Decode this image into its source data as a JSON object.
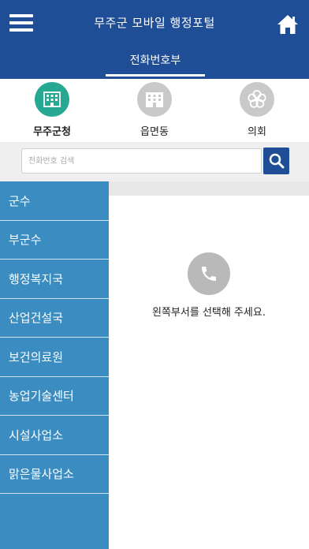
{
  "header": {
    "title": "무주군 모바일 행정포털",
    "tab_label": "전화번호부"
  },
  "categories": [
    {
      "label": "무주군청",
      "icon": "building-icon",
      "color": "#26a892",
      "active": true
    },
    {
      "label": "읍면동",
      "icon": "office-icon",
      "color": "#c9c9c9",
      "active": false
    },
    {
      "label": "의회",
      "icon": "emblem-icon",
      "color": "#c9c9c9",
      "active": false
    }
  ],
  "search": {
    "placeholder": "전화번호 검색",
    "value": ""
  },
  "sidebar": {
    "items": [
      {
        "label": "군수"
      },
      {
        "label": "부군수"
      },
      {
        "label": "행정복지국"
      },
      {
        "label": "산업건설국"
      },
      {
        "label": "보건의료원"
      },
      {
        "label": "농업기술센터"
      },
      {
        "label": "시설사업소"
      },
      {
        "label": "맑은물사업소"
      }
    ]
  },
  "content": {
    "empty_message": "왼쪽부서를 선택해 주세요.",
    "icon": "phone-icon"
  },
  "colors": {
    "header": "#1f4e96",
    "sidebar": "#3b8cc0",
    "accent_green": "#26a892",
    "muted_gray": "#c9c9c9"
  }
}
